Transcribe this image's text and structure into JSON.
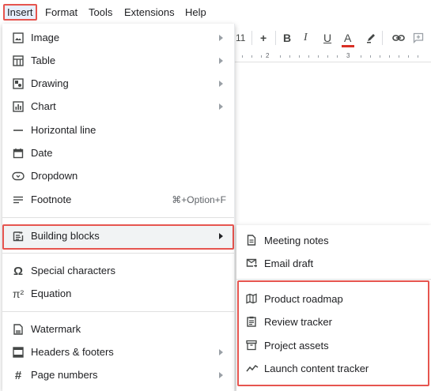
{
  "menubar": {
    "items": [
      "Insert",
      "Format",
      "Tools",
      "Extensions",
      "Help"
    ]
  },
  "toolbar": {
    "font_size": "11",
    "plus": "+",
    "bold": "B",
    "italic": "I",
    "underline": "U",
    "text_color": "A",
    "text_color_swatch": "#d93025"
  },
  "ruler": {
    "marks": [
      "2",
      "3"
    ]
  },
  "menu": {
    "items": [
      {
        "label": "Image",
        "icon": "image-icon",
        "submenu": true
      },
      {
        "label": "Table",
        "icon": "table-icon",
        "submenu": true
      },
      {
        "label": "Drawing",
        "icon": "drawing-icon",
        "submenu": true
      },
      {
        "label": "Chart",
        "icon": "chart-icon",
        "submenu": true
      },
      {
        "label": "Horizontal line",
        "icon": "horizontal-line-icon"
      },
      {
        "label": "Date",
        "icon": "calendar-icon"
      },
      {
        "label": "Dropdown",
        "icon": "dropdown-icon"
      },
      {
        "label": "Footnote",
        "icon": "footnote-icon",
        "shortcut": "⌘+Option+F"
      },
      {
        "label": "Building blocks",
        "icon": "building-blocks-icon",
        "submenu": true
      },
      {
        "label": "Special characters",
        "icon": "omega-icon"
      },
      {
        "label": "Equation",
        "icon": "pi-icon"
      },
      {
        "label": "Watermark",
        "icon": "watermark-icon"
      },
      {
        "label": "Headers & footers",
        "icon": "headers-footers-icon",
        "submenu": true
      },
      {
        "label": "Page numbers",
        "icon": "hash-icon",
        "submenu": true
      }
    ]
  },
  "submenu": {
    "items": [
      {
        "label": "Meeting notes",
        "icon": "document-icon"
      },
      {
        "label": "Email draft",
        "icon": "email-icon"
      },
      {
        "label": "Product roadmap",
        "icon": "map-icon"
      },
      {
        "label": "Review tracker",
        "icon": "clipboard-icon"
      },
      {
        "label": "Project assets",
        "icon": "archive-icon"
      },
      {
        "label": "Launch content tracker",
        "icon": "trend-icon"
      }
    ]
  },
  "colors": {
    "highlight_border": "#e6554f",
    "active_menu_bg": "#e8f0fe"
  }
}
